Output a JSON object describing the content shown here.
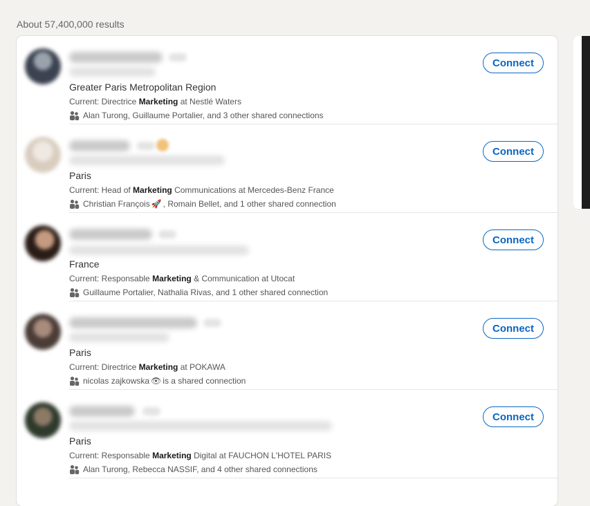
{
  "results_count": "About 57,400,000 results",
  "connect_label": "Connect",
  "results": [
    {
      "location": "Greater Paris Metropolitan Region",
      "current_prefix": "Current: Directrice ",
      "current_keyword": "Marketing",
      "current_suffix": " at Nestlé Waters",
      "shared_text": "Alan Turong, Guillaume Portalier, and 3 other shared connections",
      "avatar_color": "#3b4250"
    },
    {
      "location": "Paris",
      "current_prefix": "Current: Head of ",
      "current_keyword": "Marketing",
      "current_suffix": " Communications at Mercedes-Benz France",
      "shared_before": "Christian François ",
      "shared_emoji": "🚀",
      "shared_after": ", Romain Bellet, and 1 other shared connection",
      "avatar_color": "#d9cdbf"
    },
    {
      "location": "France",
      "current_prefix": "Current: Responsable ",
      "current_keyword": "Marketing",
      "current_suffix": " & Communication at Utocat",
      "shared_text": "Guillaume Portalier, Nathalia Rivas, and 1 other shared connection",
      "avatar_color": "#5a3d33"
    },
    {
      "location": "Paris",
      "current_prefix": "Current: Directrice ",
      "current_keyword": "Marketing",
      "current_suffix": " at POKAWA",
      "shared_before": "nicolas zajkowska ",
      "shared_emoji": "👁",
      "shared_after": " is a shared connection",
      "avatar_color": "#6b5a52"
    },
    {
      "location": "Paris",
      "current_prefix": "Current: Responsable ",
      "current_keyword": "Marketing",
      "current_suffix": " Digital at FAUCHON L'HOTEL PARIS",
      "shared_text": "Alan Turong, Rebecca NASSIF, and 4 other shared connections",
      "avatar_color": "#3f4a3a"
    }
  ],
  "colors": {
    "accent": "#0a66c2",
    "background": "#f3f2ef"
  }
}
